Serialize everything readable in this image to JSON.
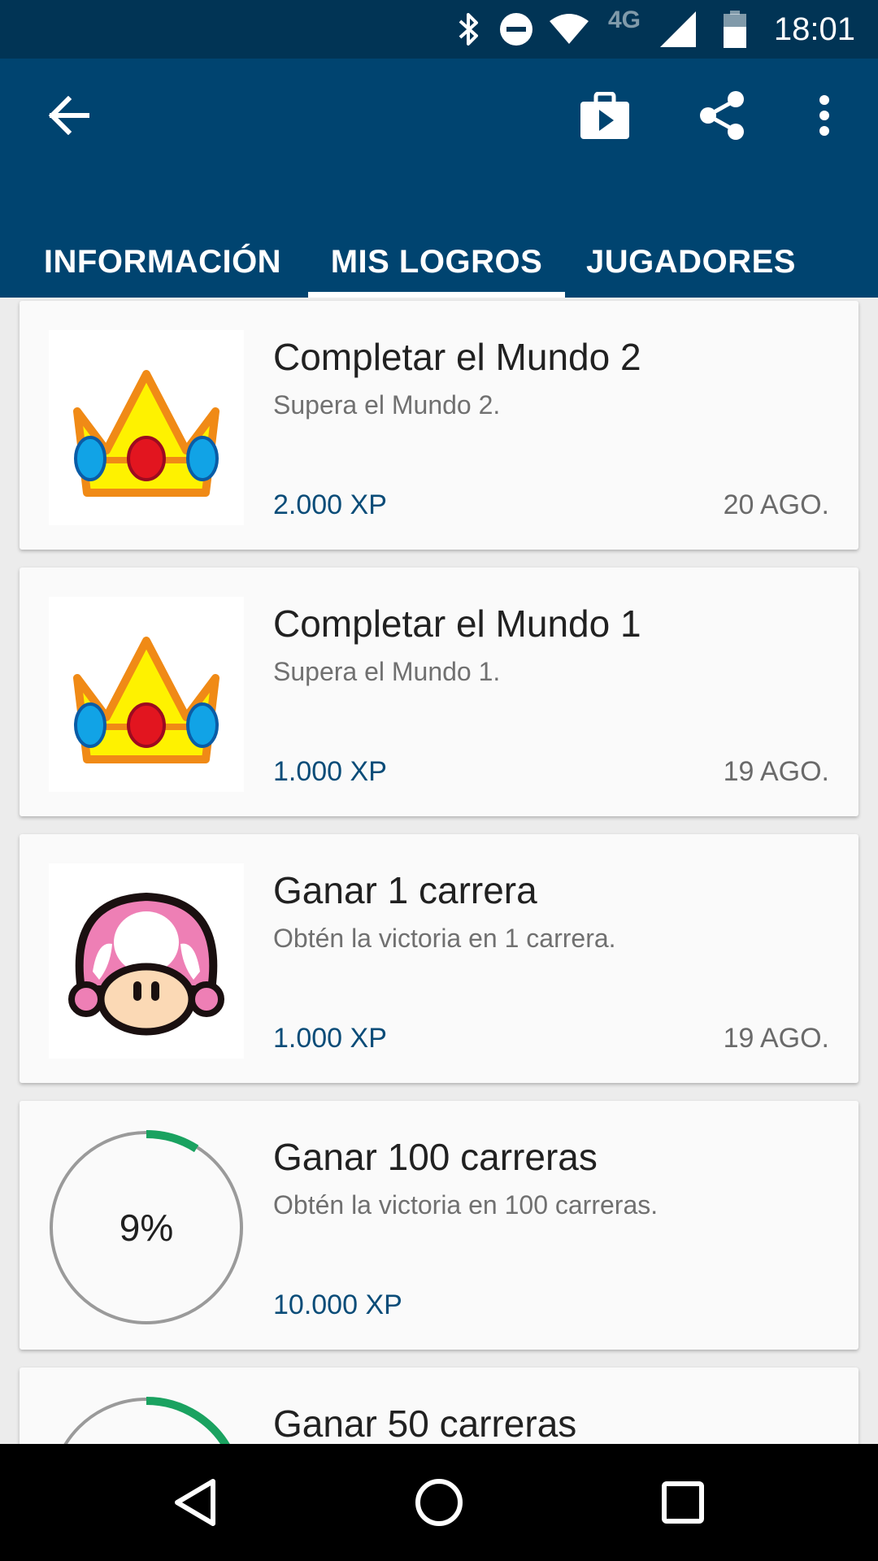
{
  "status_bar": {
    "time": "18:01",
    "network_label": "4G",
    "icons": [
      "bluetooth-icon",
      "do-not-disturb-icon",
      "wifi-icon",
      "signal-icon",
      "battery-icon"
    ]
  },
  "app_bar": {
    "icons": [
      "back-arrow-icon",
      "play-store-icon",
      "share-icon",
      "more-vert-icon"
    ],
    "background": "#004470"
  },
  "tabs": [
    {
      "label": "INFORMACIÓN",
      "selected": false
    },
    {
      "label": "MIS LOGROS",
      "selected": true
    },
    {
      "label": "JUGADORES",
      "selected": false
    }
  ],
  "achievements": [
    {
      "title": "Completar el Mundo 2",
      "description": "Supera el Mundo 2.",
      "xp": "2.000 XP",
      "date": "20 AGO.",
      "icon": "crown-icon"
    },
    {
      "title": "Completar el Mundo 1",
      "description": "Supera el Mundo 1.",
      "xp": "1.000 XP",
      "date": "19 AGO.",
      "icon": "crown-icon"
    },
    {
      "title": "Ganar 1 carrera",
      "description": "Obtén la victoria en 1 carrera.",
      "xp": "1.000 XP",
      "date": "19 AGO.",
      "icon": "toadette-icon"
    },
    {
      "title": "Ganar 100 carreras",
      "description": "Obtén la victoria en 100 carreras.",
      "xp": "10.000 XP",
      "progress_label": "9%",
      "progress": 0.09
    },
    {
      "title": "Ganar 50 carreras",
      "progress": 0.18
    }
  ],
  "colors": {
    "status_bar": "#013455",
    "accent_xp": "#0a4c78",
    "progress": "#1aa260"
  },
  "nav_bar": {
    "icons": [
      "back-nav-icon",
      "home-nav-icon",
      "recents-nav-icon"
    ]
  }
}
